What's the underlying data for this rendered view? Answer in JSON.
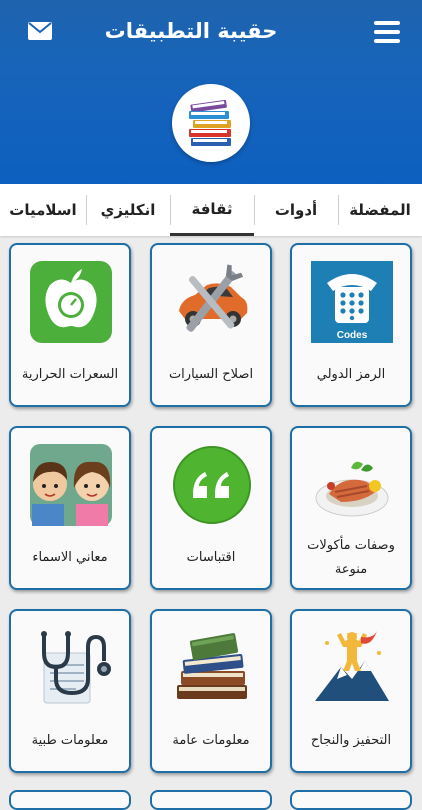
{
  "header": {
    "title": "حقيبة التطبيقات",
    "menu_icon": "hamburger-menu-icon",
    "mail_icon": "mail-icon",
    "logo_icon": "books-stack-icon"
  },
  "tabs": [
    {
      "label": "المفضلة",
      "active": false
    },
    {
      "label": "أدوات",
      "active": false
    },
    {
      "label": "ثقافة",
      "active": true
    },
    {
      "label": "انكليزي",
      "active": false
    },
    {
      "label": "اسلاميات",
      "active": false
    }
  ],
  "apps": [
    {
      "label": "الرمز الدولي",
      "icon": "phone-codes-icon"
    },
    {
      "label": "اصلاح السيارات",
      "icon": "car-repair-icon"
    },
    {
      "label": "السعرات الحرارية",
      "icon": "apple-scale-icon"
    },
    {
      "label": "وصفات مأكولات منوعة",
      "icon": "food-plate-icon"
    },
    {
      "label": "اقتباسات",
      "icon": "quote-icon"
    },
    {
      "label": "معاني الاسماء",
      "icon": "kids-icon"
    },
    {
      "label": "التحفيز والنجاح",
      "icon": "success-mountain-icon"
    },
    {
      "label": "معلومات عامة",
      "icon": "books-icon"
    },
    {
      "label": "معلومات طبية",
      "icon": "stethoscope-icon"
    }
  ],
  "codes_text": "Codes",
  "colors": {
    "app_bar": "#1864b9",
    "card_border": "#1e6fa8",
    "green": "#4cae3b"
  }
}
